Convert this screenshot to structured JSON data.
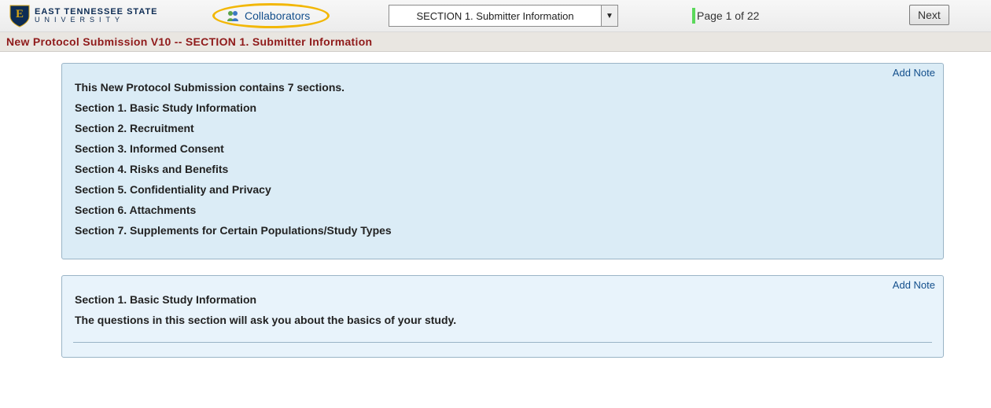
{
  "header": {
    "university_line1": "EAST TENNESSEE STATE",
    "university_line2": "UNIVERSITY",
    "collaborators_label": "Collaborators",
    "section_dropdown_text": "SECTION 1. Submitter Information",
    "dropdown_glyph": "▼",
    "page_indicator": "Page 1 of 22",
    "next_label": "Next"
  },
  "breadcrumb": "New Protocol Submission V10 -- SECTION 1. Submitter Information",
  "panel1": {
    "add_note": "Add Note",
    "intro": "This New Protocol Submission contains 7 sections.",
    "s1": "Section 1.  Basic Study Information",
    "s2": "Section 2.  Recruitment",
    "s3": "Section 3.  Informed Consent",
    "s4": "Section 4.  Risks and Benefits",
    "s5": "Section 5.  Confidentiality and Privacy",
    "s6": "Section 6.  Attachments",
    "s7": "Section 7.  Supplements for Certain Populations/Study Types"
  },
  "panel2": {
    "add_note": "Add Note",
    "title": "Section 1.  Basic Study Information",
    "desc": "The questions in this section will ask you about the basics of your study."
  }
}
